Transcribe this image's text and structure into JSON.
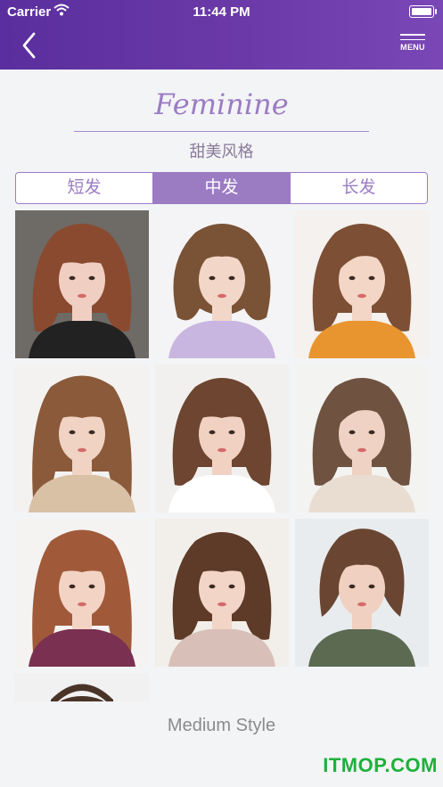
{
  "status_bar": {
    "carrier": "Carrier",
    "time": "11:44 PM"
  },
  "nav": {
    "menu_label": "MENU"
  },
  "header": {
    "title_en": "Feminine",
    "title_cn": "甜美风格"
  },
  "tabs": [
    {
      "label": "短发",
      "active": false
    },
    {
      "label": "中发",
      "active": true
    },
    {
      "label": "长发",
      "active": false
    }
  ],
  "photos": [
    {
      "bg": "#6e6a66",
      "hair": "#8a4a30",
      "skin": "#f0cfc2",
      "cloth": "#222222",
      "style": "bob-bangs"
    },
    {
      "bg": "#f4f4f6",
      "hair": "#7a5236",
      "skin": "#f2d6c8",
      "cloth": "#c9b6e0",
      "style": "curly"
    },
    {
      "bg": "#f4f1ee",
      "hair": "#7d4f34",
      "skin": "#f3d6c6",
      "cloth": "#e8952f",
      "style": "wavy-side"
    },
    {
      "bg": "#f3f2f0",
      "hair": "#8a5a3a",
      "skin": "#f0d3c3",
      "cloth": "#d9c1a6",
      "style": "bangs-long"
    },
    {
      "bg": "#f2f0ee",
      "hair": "#6d4530",
      "skin": "#f1d2c2",
      "cloth": "#ffffff",
      "style": "short-bangs-wavy"
    },
    {
      "bg": "#f3f3f1",
      "hair": "#6f5240",
      "skin": "#efd2c3",
      "cloth": "#e9ddd1",
      "style": "side-wave"
    },
    {
      "bg": "#f5f3f2",
      "hair": "#a05a3a",
      "skin": "#f3d4c4",
      "cloth": "#7a3050",
      "style": "bangs-long"
    },
    {
      "bg": "#f2efea",
      "hair": "#5e3a28",
      "skin": "#f2d5c6",
      "cloth": "#d8c0b8",
      "style": "wavy-bangs"
    },
    {
      "bg": "#e8ecef",
      "hair": "#6a4632",
      "skin": "#f0d0c0",
      "cloth": "#5d6a52",
      "style": "updo"
    },
    {
      "bg": "#f1f1f1",
      "hair": "#4a3428",
      "skin": "#f0d0c0",
      "cloth": "#ffffff",
      "style": "partial"
    }
  ],
  "caption": "Medium Style",
  "watermark": "ITMOP.COM"
}
